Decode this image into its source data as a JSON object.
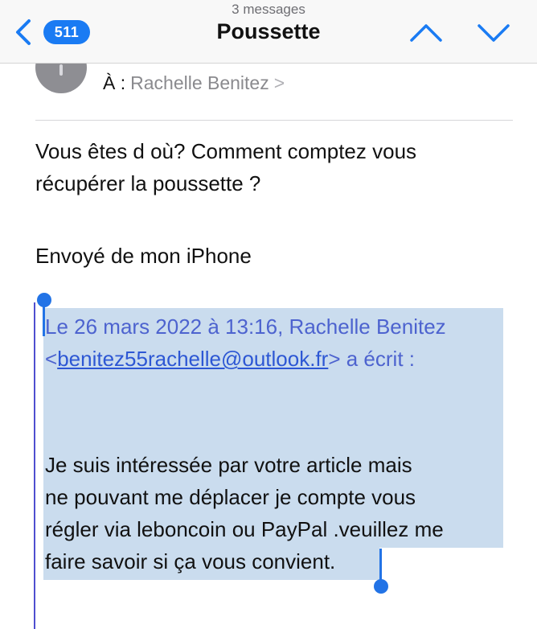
{
  "navbar": {
    "message_count": "3 messages",
    "title": "Poussette",
    "badge": "511",
    "back_icon": "chevron-left-icon",
    "up_icon": "chevron-up-icon",
    "down_icon": "chevron-down-icon",
    "accent_color": "#1a7bf3"
  },
  "header": {
    "to_label": "À :",
    "to_name": "Rachelle Benitez",
    "to_chevron": ">"
  },
  "message": {
    "line1": "Vous êtes d où? Comment comptez vous",
    "line2": "récupérer la poussette ?",
    "signature": "Envoyé de mon iPhone"
  },
  "quote": {
    "header_line1": "Le 26 mars 2022 à 13:16, Rachelle Benitez",
    "email_open": "<",
    "email": "benitez55rachelle@outlook.fr",
    "email_close": "> a écrit :",
    "body_line1": "Je suis intéressée par votre article mais",
    "body_line2": "ne pouvant me déplacer je compte vous",
    "body_line3": "régler via leboncoin ou PayPal .veuillez me",
    "body_line4": "faire savoir si ça vous convient.",
    "selection_color": "#cadcee",
    "quote_text_color": "#4d63cf"
  }
}
